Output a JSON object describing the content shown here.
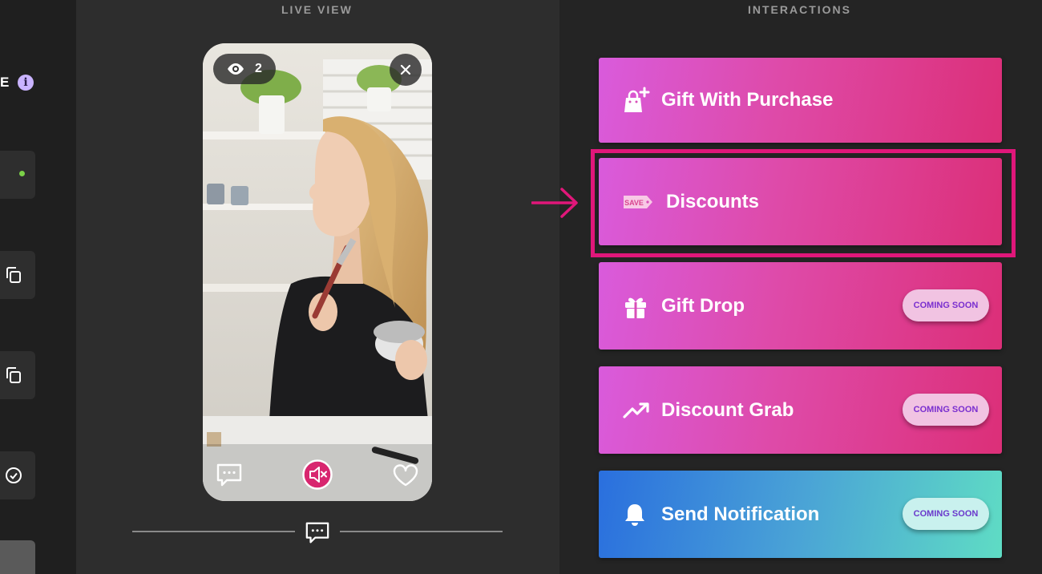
{
  "left_panel": {
    "heading_fragment": "E",
    "info_icon": "info-icon",
    "status_color": "#7bd148"
  },
  "live_view": {
    "title": "LIVE VIEW",
    "viewer_count": "2",
    "icons": {
      "viewers": "eye-icon",
      "close": "close-icon",
      "chat": "chat-icon",
      "mute": "mute-icon",
      "like": "heart-icon",
      "divider": "chat-icon"
    }
  },
  "interactions": {
    "title": "INTERACTIONS",
    "cards": [
      {
        "label": "Gift With Purchase",
        "icon": "shopping-bag-plus-icon",
        "badge": ""
      },
      {
        "label": "Discounts",
        "icon": "save-tag-icon",
        "badge": "",
        "icon_text": "SAVE",
        "selected": true
      },
      {
        "label": "Gift Drop",
        "icon": "gift-icon",
        "badge": "COMING SOON"
      },
      {
        "label": "Discount Grab",
        "icon": "trending-up-icon",
        "badge": "COMING SOON"
      },
      {
        "label": "Send Notification",
        "icon": "bell-icon",
        "badge": "COMING SOON"
      }
    ]
  },
  "colors": {
    "accent_highlight": "#e0177a",
    "card_pink_start": "#d95bdc",
    "card_pink_end": "#dc2f78",
    "card_blue_start": "#2a6fde",
    "card_blue_end": "#5fdcc4"
  }
}
